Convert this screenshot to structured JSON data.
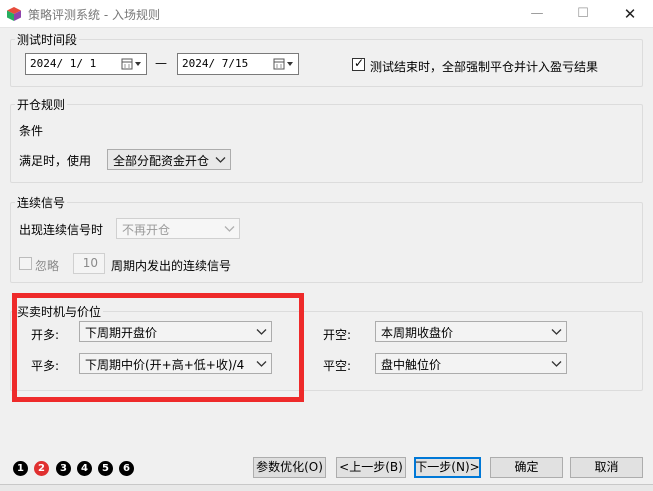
{
  "window": {
    "title": "策略评测系统 - 入场规则",
    "minimize_glyph": "—",
    "maximize_glyph": "☐",
    "close_glyph": "✕",
    "app_icon": "cube-icon"
  },
  "test_period": {
    "legend": "测试时间段",
    "start_date": "2024/ 1/ 1",
    "separator": "—",
    "end_date": "2024/ 7/15",
    "force_close_checked": true,
    "force_close_label": "测试结束时，全部强制平仓并计入盈亏结果"
  },
  "open_rule": {
    "legend": "开仓规则",
    "condition_label": "条件",
    "when_met_label": "满足时，使用",
    "when_met_value": "全部分配资金开仓"
  },
  "consecutive": {
    "legend": "连续信号",
    "appear_label": "出现连续信号时",
    "appear_value": "不再开仓",
    "ignore_checked": false,
    "ignore_label": "忽略",
    "period_value": "10",
    "period_suffix": "周期内发出的连续信号"
  },
  "timing": {
    "legend": "买卖时机与价位",
    "open_long_label": "开多:",
    "open_long_value": "下周期开盘价",
    "close_long_label": "平多:",
    "close_long_value": "下周期中价(开+高+低+收)/4",
    "open_short_label": "开空:",
    "open_short_value": "本周期收盘价",
    "close_short_label": "平空:",
    "close_short_value": "盘中触位价"
  },
  "steps": [
    "1",
    "2",
    "3",
    "4",
    "5",
    "6"
  ],
  "active_step": 2,
  "buttons": {
    "optimize": "参数优化(O)",
    "prev": "<上一步(B)",
    "next": "下一步(N)>",
    "ok": "确定",
    "cancel": "取消"
  },
  "colors": {
    "highlight_box": "#ee2a2a",
    "active_step": "#e03030",
    "default_button_border": "#0078d7"
  }
}
